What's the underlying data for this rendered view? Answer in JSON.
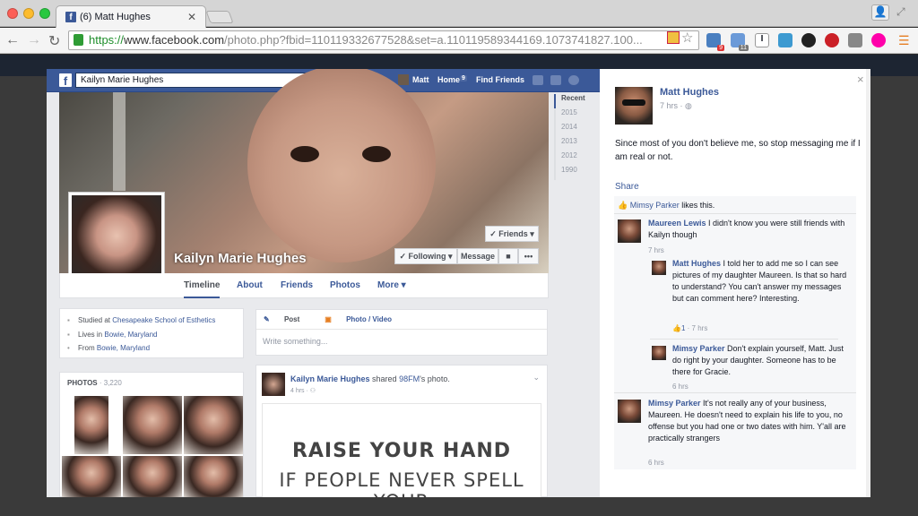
{
  "browser": {
    "tab_title": "(6) Matt Hughes",
    "tab_favicon": "f",
    "url_https": "https://",
    "url_host": "www.facebook.com",
    "url_path": "/photo.php?fbid=110119332677528&set=a.110119589344169.1073741827.100...",
    "ext_badge_1": "9",
    "ext_badge_2": "11"
  },
  "fb_bar": {
    "logo": "f",
    "search_value": "Kailyn Marie Hughes",
    "user": "Matt",
    "home": "Home",
    "home_count": "9",
    "find_friends": "Find Friends"
  },
  "profile": {
    "name": "Kailyn Marie Hughes",
    "friends_btn": "✓ Friends ▾",
    "following_btn": "✓ Following ▾",
    "message_btn": "Message",
    "more_btn": "•••",
    "tabs": [
      "Timeline",
      "About",
      "Friends",
      "Photos",
      "More ▾"
    ],
    "years": [
      "Recent",
      "2015",
      "2014",
      "2013",
      "2012",
      "1990"
    ],
    "about": {
      "studied_prefix": "Studied at ",
      "studied_link": "Chesapeake School of Esthetics",
      "lives_prefix": "Lives in ",
      "lives_link": "Bowie, Maryland",
      "from_prefix": "From ",
      "from_link": "Bowie, Maryland"
    },
    "photos_label": "PHOTOS",
    "photos_count": "· 3,220",
    "composer_post": "Post",
    "composer_photo": "Photo / Video",
    "composer_placeholder": "Write something...",
    "post_author": "Kailyn Marie Hughes",
    "post_action": " shared ",
    "post_source": "98FM",
    "post_suffix": "'s photo.",
    "post_time": "4 hrs · ",
    "post_image_line1": "RAISE YOUR HAND",
    "post_image_line2": "IF PEOPLE NEVER SPELL YOUR"
  },
  "panel": {
    "close": "×",
    "author": "Matt Hughes",
    "time": "7 hrs · ",
    "status": "Since most of you don't believe me, so stop messaging me if I am real or not.",
    "share": "Share",
    "like_user": "Mimsy Parker",
    "like_suffix": " likes this.",
    "comments": [
      {
        "name": "Maureen Lewis",
        "text": " I didn't know you were still friends with Kailyn though",
        "time": "7 hrs"
      },
      {
        "name": "Matt Hughes",
        "text": " I told her to add me so I can see pictures of my daughter Maureen. Is that so hard to understand? You can't answer my messages but can comment here? Interesting.",
        "likes": "1",
        "time": " · 7 hrs"
      },
      {
        "name": "Mimsy Parker",
        "text": " Don't explain yourself, Matt. Just do right by your daughter. Someone has to be there for Gracie.",
        "time": "6 hrs"
      },
      {
        "name": "Mimsy Parker",
        "text": " It's not really any of your business, Maureen. He doesn't need to explain his life to you, no offense but you had one or two dates with him. Y'all are practically strangers",
        "time": "6 hrs"
      }
    ]
  },
  "colors": {
    "fb_blue": "#3b5998",
    "link": "#3b5998",
    "grey_text": "#9197a3"
  }
}
